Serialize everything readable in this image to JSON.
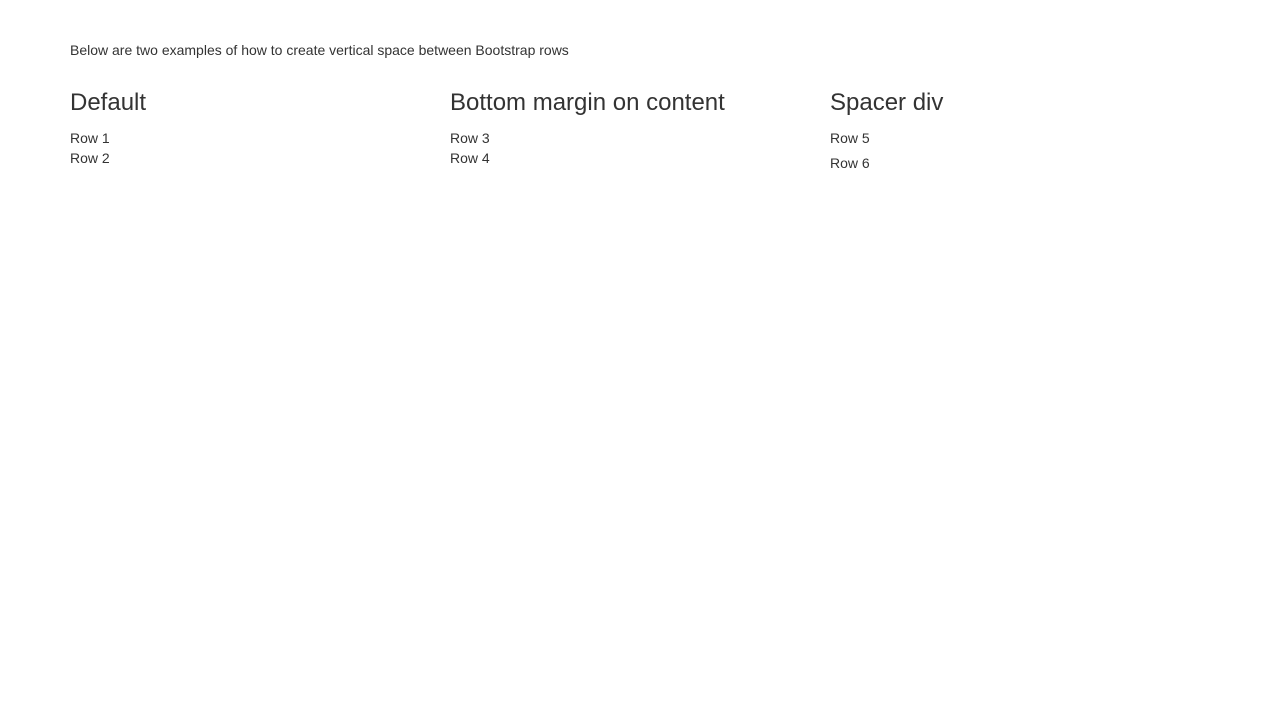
{
  "intro": "Below are two examples of how to create vertical space between Bootstrap rows",
  "columns": [
    {
      "title": "Default",
      "rows": [
        "Row 1",
        "Row 2"
      ]
    },
    {
      "title": "Bottom margin on content",
      "rows": [
        "Row 3",
        "Row 4"
      ]
    },
    {
      "title": "Spacer div",
      "rows": [
        "Row 5",
        "Row 6"
      ]
    }
  ]
}
